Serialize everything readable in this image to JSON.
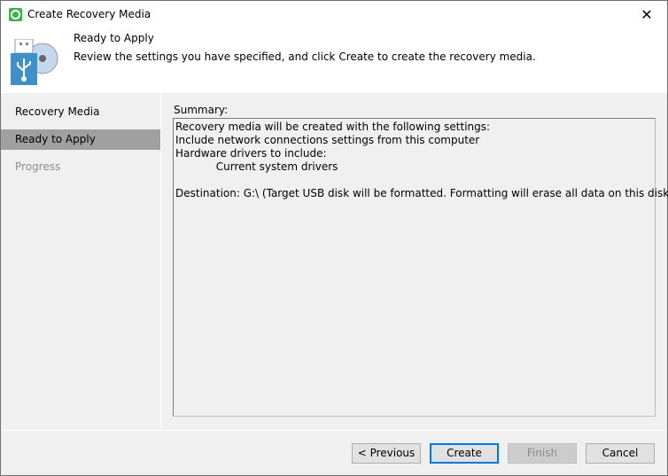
{
  "window": {
    "title": "Create Recovery Media",
    "close_icon": "close-icon"
  },
  "header": {
    "title": "Ready to Apply",
    "description": "Review the settings you have specified, and click Create to create the recovery media."
  },
  "sidebar": {
    "items": [
      {
        "label": "Recovery Media",
        "state": "normal"
      },
      {
        "label": "Ready to Apply",
        "state": "active"
      },
      {
        "label": "Progress",
        "state": "disabled"
      }
    ]
  },
  "summary": {
    "label": "Summary:",
    "text": "Recovery media will be created with the following settings:\nInclude network connections settings from this computer\nHardware drivers to include:\n            Current system drivers\n\nDestination: G:\\ (Target USB disk will be formatted. Formatting will erase all data on this disk.)"
  },
  "buttons": {
    "previous": "< Previous",
    "create": "Create",
    "finish": "Finish",
    "cancel": "Cancel"
  },
  "colors": {
    "accent": "#0078d7",
    "app_icon": "#3cb34a",
    "usb": "#3f8fc8"
  }
}
